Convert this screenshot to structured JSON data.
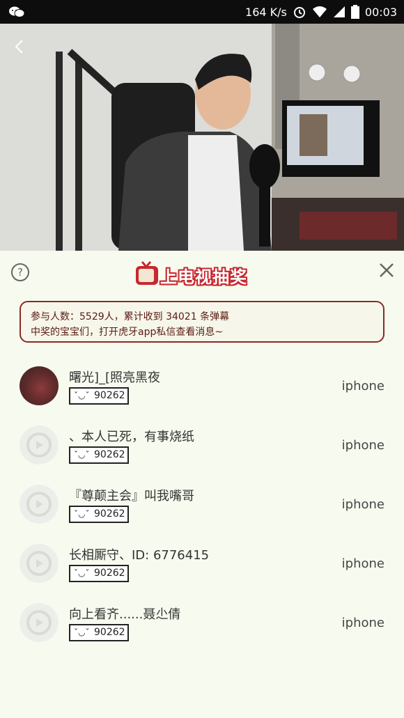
{
  "status_bar": {
    "network_speed": "164 K/s",
    "time": "00:03",
    "icons": [
      "wechat-icon",
      "alarm-icon",
      "wifi-icon",
      "signal-icon",
      "battery-icon"
    ]
  },
  "video": {
    "back_icon": "chevron-left-icon"
  },
  "panel": {
    "title": "上电视抽奖",
    "help_icon": "question-circle-icon",
    "close_icon": "close-icon",
    "info": {
      "line1": "参与人数：5529人，累计收到 34021 条弹幕",
      "line2": "中奖的宝宝们，打开虎牙app私信查看消息~"
    },
    "winners": [
      {
        "name": "曙光]_[照亮黑夜",
        "badge_face": "ˇ◡ˇ",
        "badge_number": "90262",
        "device": "iphone"
      },
      {
        "name": "、本人已死，有事烧纸",
        "badge_face": "ˇ◡ˇ",
        "badge_number": "90262",
        "device": "iphone"
      },
      {
        "name": "『尊颠主会』叫我嘴哥",
        "badge_face": "ˇ◡ˇ",
        "badge_number": "90262",
        "device": "iphone"
      },
      {
        "name": "长相厮守、ID: 6776415",
        "badge_face": "ˇ◡ˇ",
        "badge_number": "90262",
        "device": "iphone"
      },
      {
        "name": "向上看齐......聂尐倩",
        "badge_face": "ˇ◡ˇ",
        "badge_number": "90262",
        "device": "iphone"
      }
    ]
  },
  "colors": {
    "accent_red": "#c8282e",
    "border_brown": "#8a2a25",
    "panel_bg": "#f7fbef"
  }
}
